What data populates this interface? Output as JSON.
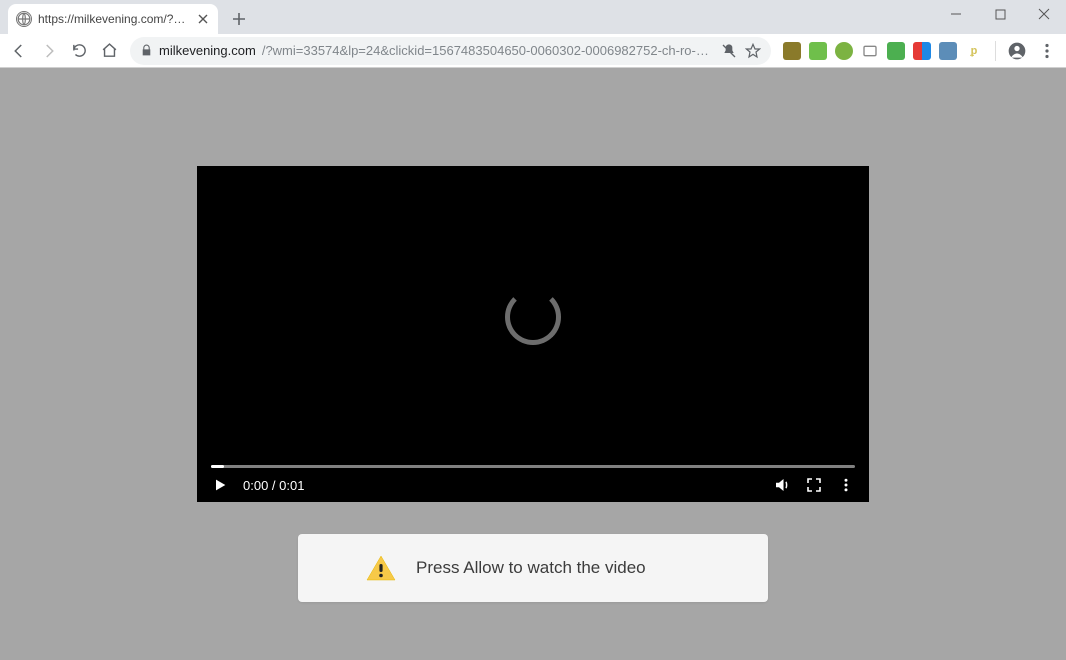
{
  "window": {
    "tab_title": "https://milkevening.com/?wmi=",
    "url_host": "milkevening.com",
    "url_rest": "/?wmi=33574&lp=24&clickid=1567483504650-0060302-0006982752-ch-ro-3923064971200..."
  },
  "video": {
    "time_current": "0:00",
    "time_total": "0:01"
  },
  "banner": {
    "message": "Press Allow to watch the video"
  }
}
